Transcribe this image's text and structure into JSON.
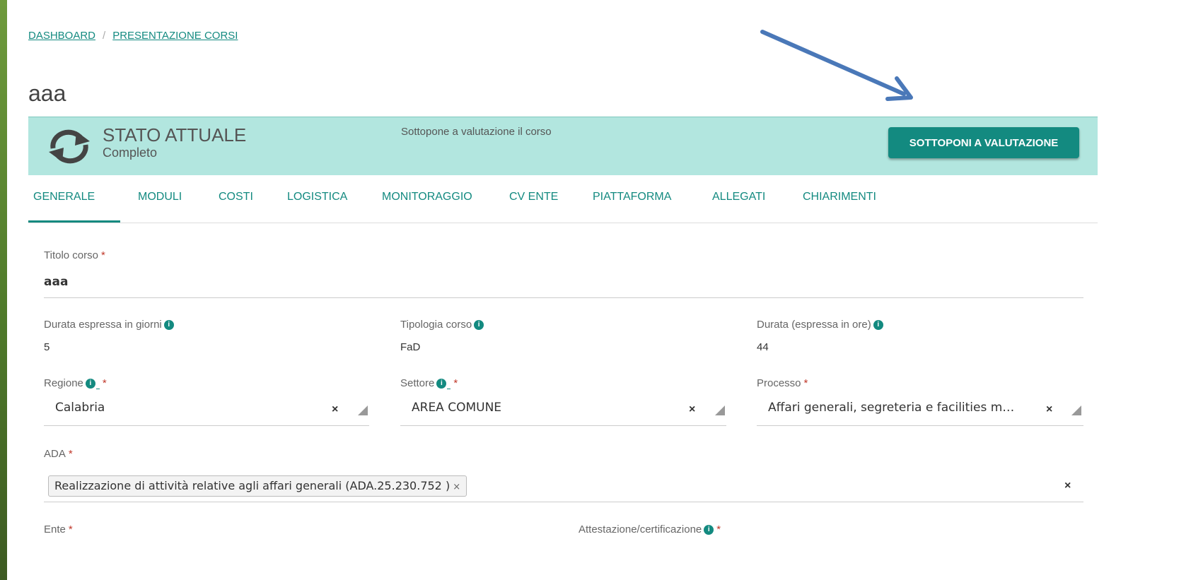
{
  "breadcrumb": [
    "DASHBOARD",
    "PRESENTAZIONE CORSI"
  ],
  "breadcrumb_separator": "/",
  "page_title": "aaa",
  "status": {
    "title": "STATO ATTUALE",
    "value": "Completo",
    "description": "Sottopone a valutazione il corso",
    "button_label": "SOTTOPONI A VALUTAZIONE",
    "icon": "sync-icon"
  },
  "tabs": [
    "GENERALE",
    "MODULI",
    "COSTI",
    "LOGISTICA",
    "MONITORAGGIO",
    "CV ENTE",
    "PIATTAFORMA",
    "ALLEGATI",
    "CHIARIMENTI"
  ],
  "active_tab": "GENERALE",
  "required_mark": "*",
  "info_icon": "i",
  "form": {
    "titolo_corso": {
      "label": "Titolo corso",
      "value": "aaa"
    },
    "durata_giorni": {
      "label": "Durata espressa in giorni",
      "value": "5"
    },
    "tipologia": {
      "label": "Tipologia corso",
      "value": "FaD"
    },
    "durata_ore": {
      "label": "Durata (espressa in ore)",
      "value": "44"
    },
    "regione": {
      "label": "Regione",
      "value": "Calabria"
    },
    "settore": {
      "label": "Settore",
      "value": "AREA COMUNE"
    },
    "processo": {
      "label": "Processo",
      "value": "Affari generali, segreteria e facilities m…"
    },
    "ada": {
      "label": "ADA",
      "tag": "Realizzazione di attività relative agli affari generali (ADA.25.230.752 )"
    },
    "ente": {
      "label": "Ente"
    },
    "attestazione": {
      "label": "Attestazione/certificazione"
    }
  },
  "clear_symbol": "×",
  "colors": {
    "accent": "#138a80",
    "status_bg": "#b2e6df",
    "arrow": "#4a78b8",
    "required": "#c0392b"
  }
}
